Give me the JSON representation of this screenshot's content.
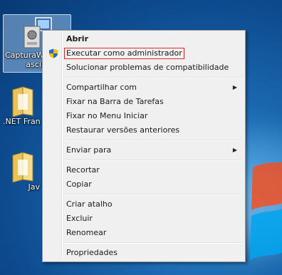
{
  "desktop": {
    "icons": [
      {
        "label": "CapturaW",
        "label2": "ascii",
        "selected": true
      },
      {
        "label": ".NET Fran"
      },
      {
        "label": "Jav"
      }
    ]
  },
  "menu": {
    "groups": [
      [
        {
          "label": "Abrir",
          "bold": true
        },
        {
          "label": "Executar como administrador",
          "icon": "uac-shield-icon",
          "highlighted": true
        },
        {
          "label": "Solucionar problemas de compatibilidade"
        }
      ],
      [
        {
          "label": "Compartilhar com",
          "submenu": true
        },
        {
          "label": "Fixar na Barra de Tarefas"
        },
        {
          "label": "Fixar no Menu Iniciar"
        },
        {
          "label": "Restaurar versões anteriores"
        }
      ],
      [
        {
          "label": "Enviar para",
          "submenu": true
        }
      ],
      [
        {
          "label": "Recortar"
        },
        {
          "label": "Copiar"
        }
      ],
      [
        {
          "label": "Criar atalho"
        },
        {
          "label": "Excluir"
        },
        {
          "label": "Renomear"
        }
      ],
      [
        {
          "label": "Propriedades"
        }
      ]
    ],
    "submenu_arrow": "▶"
  },
  "colors": {
    "highlight_border": "#d52d2d",
    "menu_background": "#f0f0f0"
  }
}
